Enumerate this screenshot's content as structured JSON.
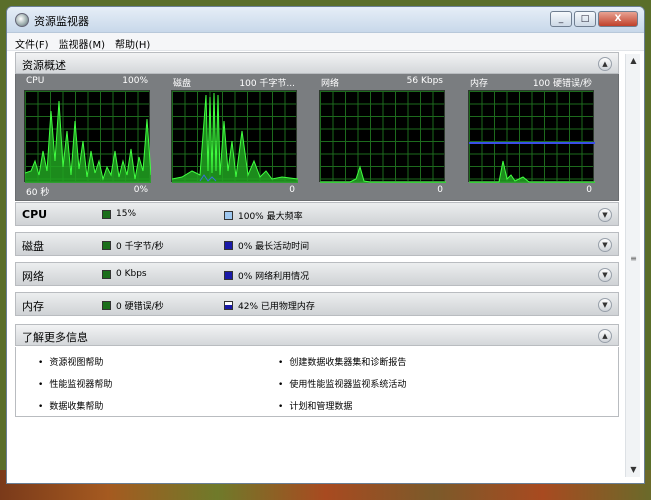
{
  "window": {
    "title": "资源监视器",
    "buttons": [
      "_",
      "□",
      "X"
    ]
  },
  "menu": [
    "文件(F)",
    "监视器(M)",
    "帮助(H)"
  ],
  "overview": {
    "title": "资源概述",
    "graphs": [
      {
        "name": "CPU",
        "max": "100%",
        "bottom_left": "60 秒",
        "bottom_right": "0%"
      },
      {
        "name": "磁盘",
        "max": "100 千字节...",
        "bottom_left": "",
        "bottom_right": "0"
      },
      {
        "name": "网络",
        "max": "56 Kbps",
        "bottom_left": "",
        "bottom_right": "0"
      },
      {
        "name": "内存",
        "max": "100 硬错误/秒",
        "bottom_left": "",
        "bottom_right": "0"
      }
    ]
  },
  "details": [
    {
      "title": "CPU",
      "stat1": "15%",
      "stat2": "100% 最大频率",
      "color1": "#1b6e1b",
      "color2": "#9ec7f0"
    },
    {
      "title": "磁盘",
      "stat1": "0 千字节/秒",
      "stat2": "0% 最长活动时间",
      "color1": "#1b6e1b",
      "color2": "#1a1aa8"
    },
    {
      "title": "网络",
      "stat1": "0 Kbps",
      "stat2": "0% 网络利用情况",
      "color1": "#1b6e1b",
      "color2": "#1a1aa8"
    },
    {
      "title": "内存",
      "stat1": "0 硬错误/秒",
      "stat2": "42% 已用物理内存",
      "color1": "#1b6e1b",
      "color2": "#1a1aa8"
    }
  ],
  "learn_more": {
    "title": "了解更多信息",
    "links_left": [
      "资源视图帮助",
      "性能监视器帮助",
      "数据收集帮助"
    ],
    "links_right": [
      "创建数据收集器集和诊断报告",
      "使用性能监视器监视系统活动",
      "计划和管理数据"
    ]
  }
}
